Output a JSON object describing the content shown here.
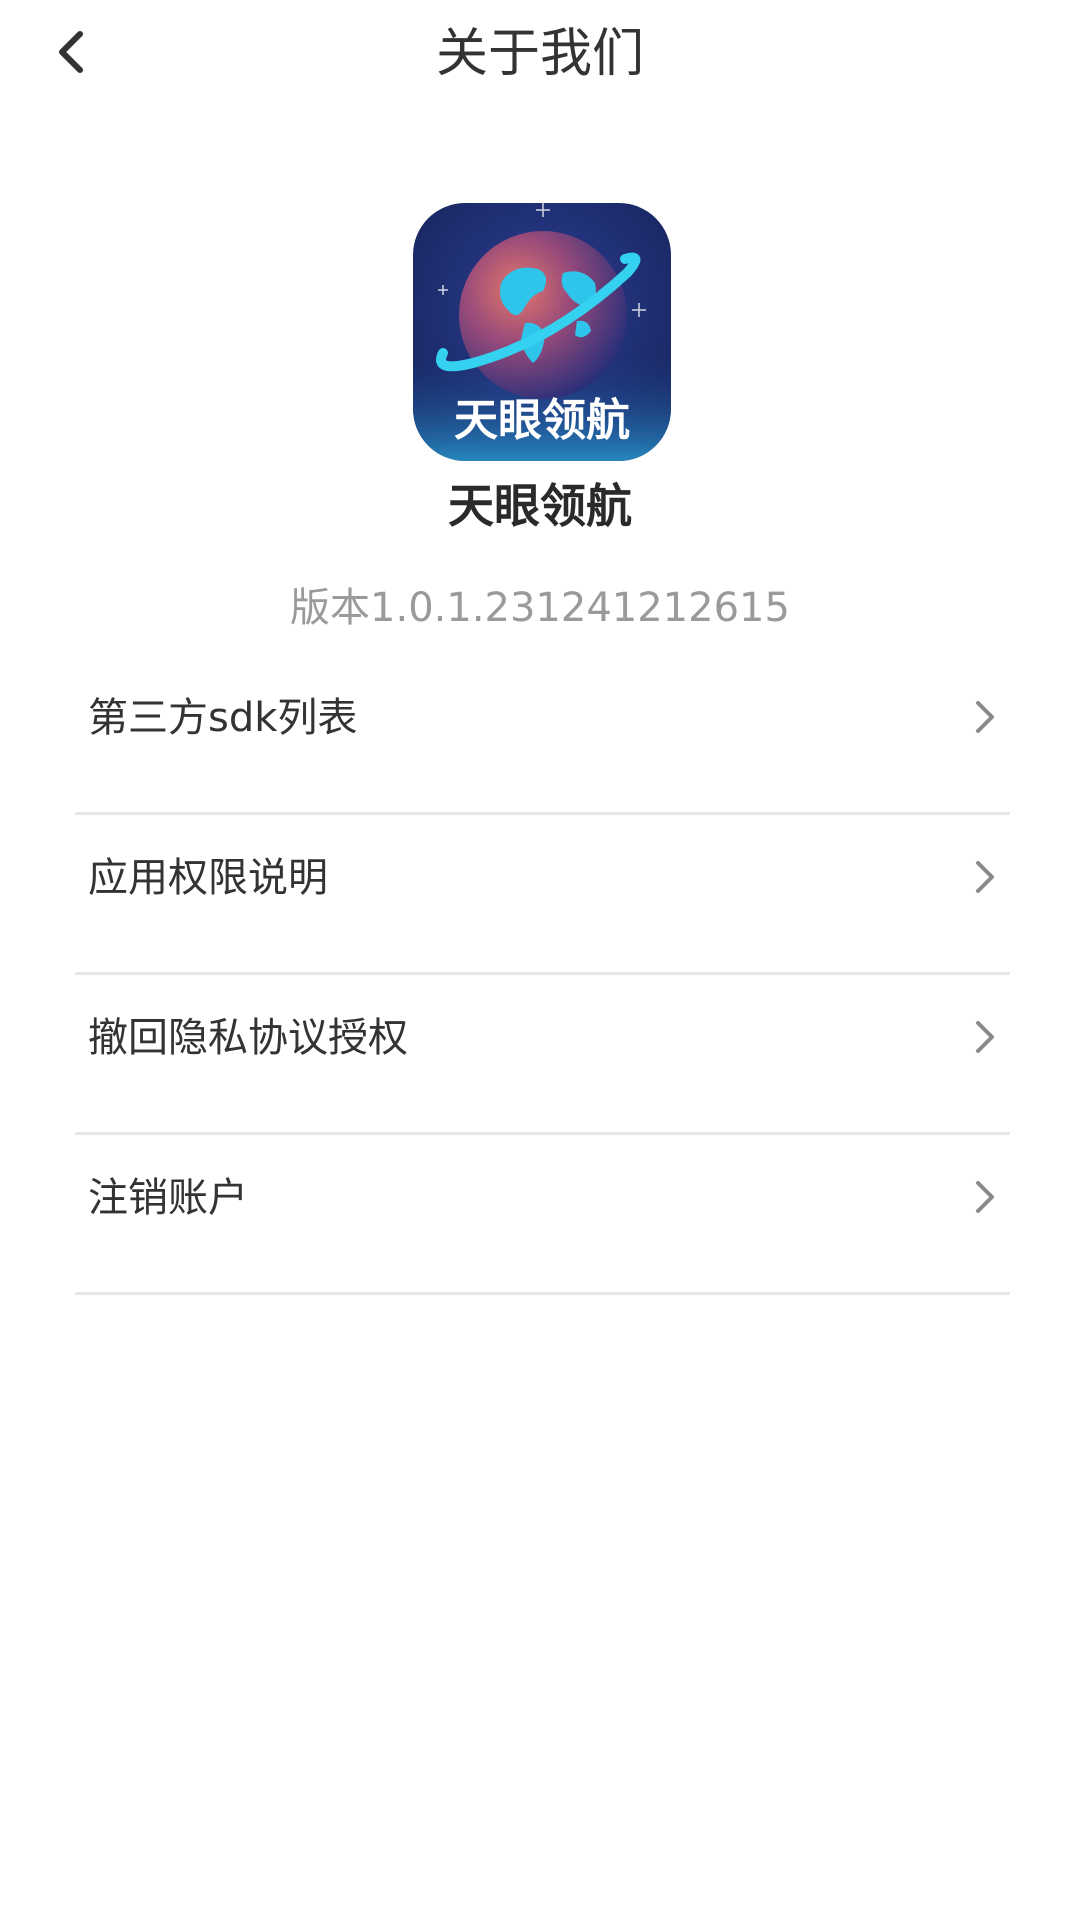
{
  "header": {
    "title": "关于我们",
    "back_icon": "chevron-left-icon"
  },
  "app": {
    "logo_text": "天眼领航",
    "name": "天眼领航",
    "version": "版本1.0.1.231241212615"
  },
  "menu": {
    "items": [
      {
        "label": "第三方sdk列表",
        "icon": "chevron-right-icon"
      },
      {
        "label": "应用权限说明",
        "icon": "chevron-right-icon"
      },
      {
        "label": "撤回隐私协议授权",
        "icon": "chevron-right-icon"
      },
      {
        "label": "注销账户",
        "icon": "chevron-right-icon"
      }
    ]
  },
  "colors": {
    "title_text": "#333333",
    "version_text": "#9a9a9a",
    "divider": "#e6e6e6",
    "logo_bg": "#1d2f73",
    "globe_cyan": "#2fc4ea"
  }
}
